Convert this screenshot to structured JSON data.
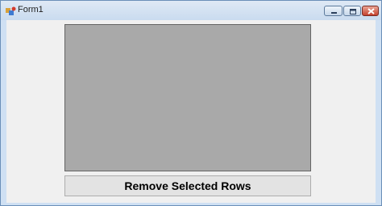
{
  "window": {
    "title": "Form1",
    "controls": {
      "minimize_icon": "minimize-icon",
      "maximize_icon": "maximize-icon",
      "close_icon": "close-icon"
    }
  },
  "main": {
    "remove_button_label": "Remove Selected Rows"
  },
  "colors": {
    "grid_background": "#a9a9a9",
    "form_background": "#f0f0f0",
    "titlebar": "#d3e2f3",
    "close_button": "#c4422f"
  }
}
